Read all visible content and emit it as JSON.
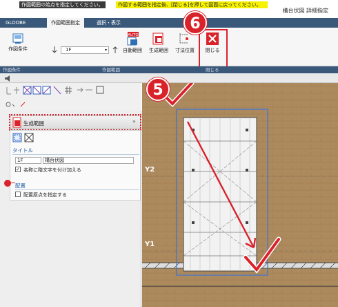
{
  "page_header": "構台伏図 詳細指定",
  "ribbon": {
    "tabs": [
      "GLOOBE",
      "作図範囲指定",
      "選択・表示"
    ],
    "active_tab": 1,
    "buttons": {
      "draw_conditions": "作図条件",
      "auto_range": "自動範囲",
      "auto_badge": "AUTO",
      "generate_range": "生成範囲",
      "dimension_position": "寸法位置",
      "close": "閉じる"
    },
    "floor_combo": "1F",
    "groups": [
      "作図条件",
      "作図範囲",
      "閉じる"
    ]
  },
  "prompt": {
    "left": "作図範囲の始点を指定してください。",
    "right": "作図する範囲を指定後、[閉じる]を押して図面に戻ってください。"
  },
  "panel": {
    "title": "生成範囲",
    "title_section": "タイトル",
    "floor_value": "1F",
    "title_value": "構台伏図",
    "add_floor_text": "名称に階文字を付け加える",
    "add_floor_checked": true,
    "placement_section": "配置",
    "placement_origin": "配置原点を指定する",
    "placement_checked": false
  },
  "canvas": {
    "grid_labels": [
      "Y2",
      "Y1"
    ]
  },
  "steps": [
    "6",
    "5"
  ],
  "colors": {
    "ribbon": "#39587a",
    "canvas_bg": "#ad8a5e",
    "highlight": "#d9222a",
    "prompt_yellow": "#f7f200",
    "guide_blue": "#3a73d6"
  }
}
